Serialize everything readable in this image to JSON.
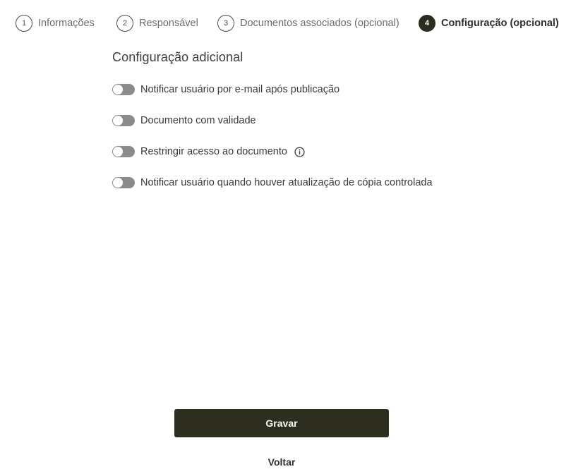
{
  "stepper": {
    "steps": [
      {
        "number": "1",
        "label": "Informações"
      },
      {
        "number": "2",
        "label": "Responsável"
      },
      {
        "number": "3",
        "label": "Documentos associados (opcional)"
      },
      {
        "number": "4",
        "label": "Configuração (opcional)"
      }
    ],
    "active_step": 4
  },
  "section": {
    "title": "Configuração adicional",
    "options": [
      {
        "label": "Notificar usuário por e-mail após publicação",
        "enabled": false
      },
      {
        "label": "Documento com validade",
        "enabled": false
      },
      {
        "label": "Restringir acesso ao documento",
        "enabled": false,
        "icon": "info-icon"
      },
      {
        "label": "Notificar usuário quando houver atualização de cópia controlada",
        "enabled": false
      }
    ]
  },
  "actions": {
    "save_label": "Gravar",
    "back_label": "Voltar"
  },
  "colors": {
    "primary": "#2e2e20",
    "toggle_off": "#8c8c8c",
    "text": "#3a3a3a"
  }
}
